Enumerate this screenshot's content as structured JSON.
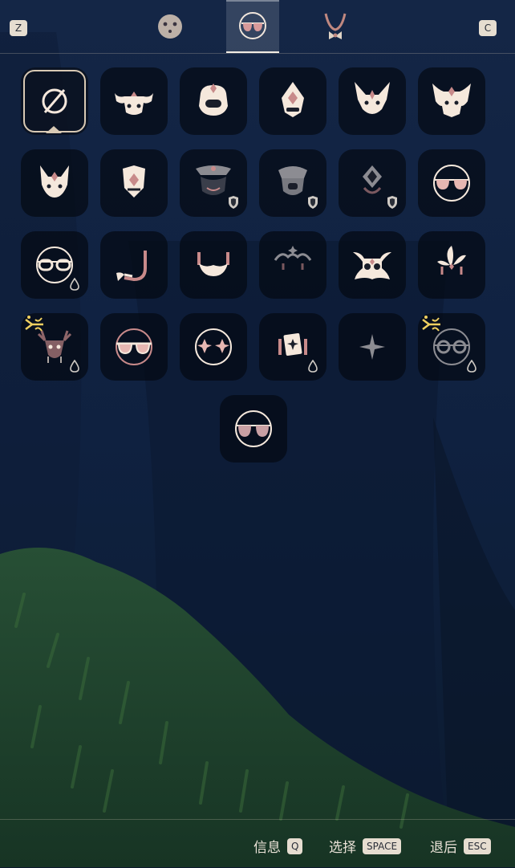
{
  "header": {
    "left_key": "Z",
    "right_key": "C",
    "tabs": [
      {
        "icon": "face-icon",
        "active": false
      },
      {
        "icon": "glasses-icon",
        "active": true
      },
      {
        "icon": "necklace-icon",
        "active": false
      }
    ]
  },
  "grid": {
    "items": [
      {
        "icon": "none-icon",
        "selected": true
      },
      {
        "icon": "bull-mask-icon"
      },
      {
        "icon": "helmet-mask-icon"
      },
      {
        "icon": "diamond-mask-icon"
      },
      {
        "icon": "horned-mask-icon"
      },
      {
        "icon": "demon-mask-icon"
      },
      {
        "icon": "fox-mask-icon"
      },
      {
        "icon": "shield-mask-icon"
      },
      {
        "icon": "crown-mask-icon",
        "badge": "shield-icon",
        "locked": true
      },
      {
        "icon": "ram-mask-icon",
        "badge": "shield-icon",
        "locked": true
      },
      {
        "icon": "gem-mask-icon",
        "badge": "shield-icon",
        "locked": true
      },
      {
        "icon": "sunglasses-icon"
      },
      {
        "icon": "round-glasses-icon",
        "badge": "drop-icon"
      },
      {
        "icon": "mustache-hook-icon"
      },
      {
        "icon": "beard-icon"
      },
      {
        "icon": "spiral-mustache-icon",
        "locked": true
      },
      {
        "icon": "winged-mask-icon"
      },
      {
        "icon": "feather-headdress-icon"
      },
      {
        "icon": "antler-mask-icon",
        "badge": "drop-icon",
        "sparkle": true
      },
      {
        "icon": "pink-glasses-icon"
      },
      {
        "icon": "star-glasses-icon"
      },
      {
        "icon": "card-mask-icon",
        "badge": "drop-icon"
      },
      {
        "icon": "star-icon",
        "locked": true
      },
      {
        "icon": "wire-glasses-icon",
        "badge": "drop-icon",
        "sparkle": true,
        "locked": true
      },
      {
        "icon": "rose-glasses-icon"
      }
    ]
  },
  "footer": {
    "info_label": "信息",
    "info_key": "Q",
    "select_label": "选择",
    "select_key": "SPACE",
    "back_label": "退后",
    "back_key": "ESC"
  },
  "colors": {
    "icon_cream": "#f5e8dc",
    "accent_rose": "#c88a8a",
    "dim": "#8c8c92"
  }
}
